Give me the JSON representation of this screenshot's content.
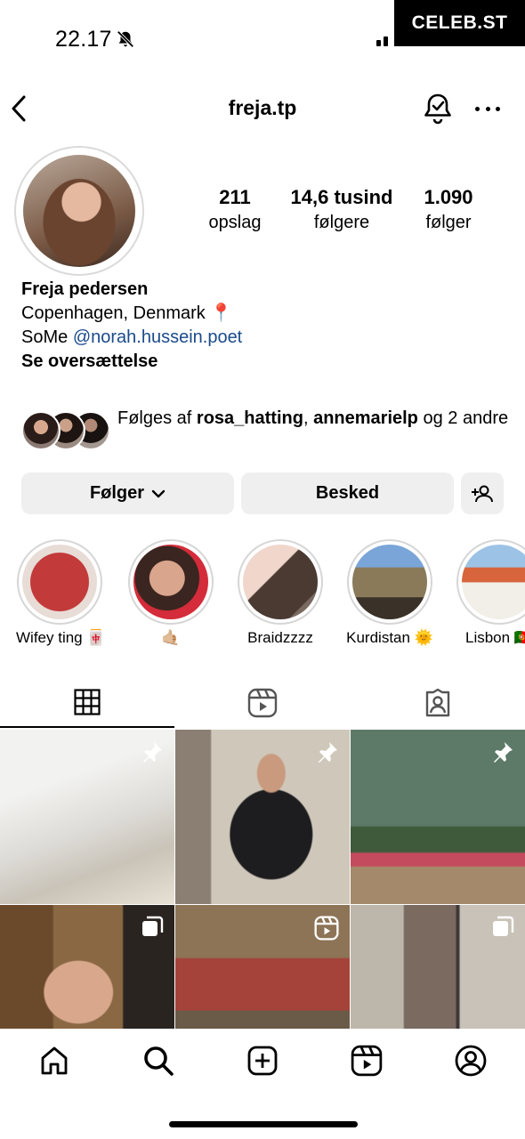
{
  "status_bar": {
    "time": "22.17",
    "mute_icon": "bell-slash-icon"
  },
  "watermark": {
    "text": "CELEB.ST"
  },
  "header": {
    "username": "freja.tp",
    "back_icon": "chevron-left-icon",
    "notify_icon": "bell-check-icon",
    "more_icon": "ellipsis-icon"
  },
  "stats": [
    {
      "value": "211",
      "label": "opslag"
    },
    {
      "value": "14,6 tusind",
      "label": "følgere"
    },
    {
      "value": "1.090",
      "label": "følger"
    }
  ],
  "bio": {
    "name": "Freja pedersen",
    "location": "Copenhagen, Denmark 📍",
    "some_prefix": "SoMe ",
    "mention": "@norah.hussein.poet",
    "translate": "Se oversættelse"
  },
  "mutual": {
    "prefix": "Følges af ",
    "user1": "rosa_hatting",
    "separator": ", ",
    "user2": "annemarielp",
    "suffix": " og 2 andre"
  },
  "buttons": {
    "follow": "Følger",
    "message": "Besked"
  },
  "highlights": [
    {
      "label": "Wifey ting 🀄"
    },
    {
      "label": "🤙🏼"
    },
    {
      "label": "Braidzzzz"
    },
    {
      "label": "Kurdistan 🌞"
    },
    {
      "label": "Lisbon 🇵🇹"
    }
  ],
  "tabs": [
    {
      "name": "grid",
      "icon": "grid-icon",
      "active": true
    },
    {
      "name": "reels",
      "icon": "reels-icon",
      "active": false
    },
    {
      "name": "tagged",
      "icon": "tagged-user-icon",
      "active": false
    }
  ],
  "posts": [
    {
      "badge": "pin-icon"
    },
    {
      "badge": "pin-icon"
    },
    {
      "badge": "pin-icon"
    },
    {
      "badge": "carousel-icon"
    },
    {
      "badge": "reel-icon"
    },
    {
      "badge": "carousel-icon"
    }
  ],
  "bottom_nav": [
    "home-icon",
    "search-icon",
    "create-icon",
    "reels-icon",
    "profile-icon"
  ],
  "colors": {
    "mention": "#1b4a8a",
    "button_bg": "#efefef"
  }
}
